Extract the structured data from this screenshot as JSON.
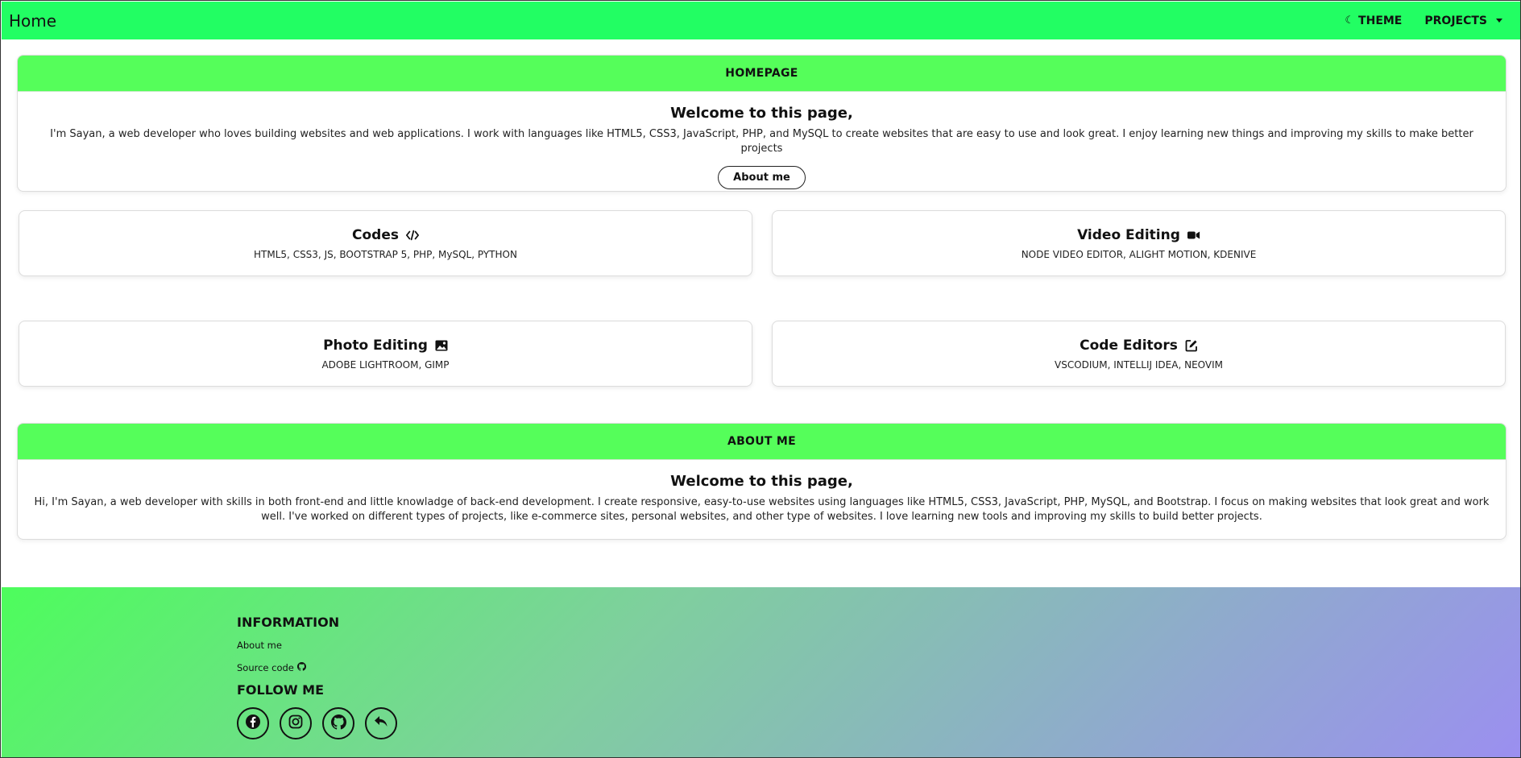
{
  "navbar": {
    "brand": "Home",
    "theme_label": "THEME",
    "projects_label": "PROJECTS"
  },
  "homepage": {
    "header": "HOMEPAGE",
    "title": "Welcome to this page,",
    "text": "I'm Sayan, a web developer who loves building websites and web applications. I work with languages like HTML5, CSS3, JavaScript, PHP, and MySQL to create websites that are easy to use and look great. I enjoy learning new things and improving my skills to make better projects",
    "button": "About me"
  },
  "skills": [
    {
      "title": "Codes",
      "icon": "code-icon",
      "text": "HTML5, CSS3, JS, BOOTSTRAP 5, PHP, MySQL, PYTHON"
    },
    {
      "title": "Video Editing",
      "icon": "video-camera-icon",
      "text": "NODE VIDEO EDITOR, ALIGHT MOTION, KDENIVE"
    },
    {
      "title": "Photo Editing",
      "icon": "image-icon",
      "text": "ADOBE LIGHTROOM, GIMP"
    },
    {
      "title": "Code Editors",
      "icon": "edit-icon",
      "text": "VSCODIUM, INTELLIJ IDEA, NEOVIM"
    }
  ],
  "about": {
    "header": "ABOUT ME",
    "title": "Welcome to this page,",
    "text": "Hi, I'm Sayan, a web developer with skills in both front-end and little knowladge of back-end development. I create responsive, easy-to-use websites using languages like HTML5, CSS3, JavaScript, PHP, MySQL, and Bootstrap. I focus on making websites that look great and work well. I've worked on different types of projects, like e-commerce sites, personal websites, and other type of websites. I love learning new tools and improving my skills to build better projects."
  },
  "footer": {
    "info_heading": "INFORMATION",
    "about_link": "About me",
    "source_link": "Source code",
    "follow_heading": "FOLLOW ME",
    "socials": [
      "facebook-icon",
      "instagram-icon",
      "github-icon",
      "reply-icon"
    ]
  },
  "colors": {
    "navbar": "#22fe63",
    "section_header": "#55fe5a",
    "footer_gradient_start": "#4dfd5c",
    "footer_gradient_end": "#9b8ff0"
  }
}
